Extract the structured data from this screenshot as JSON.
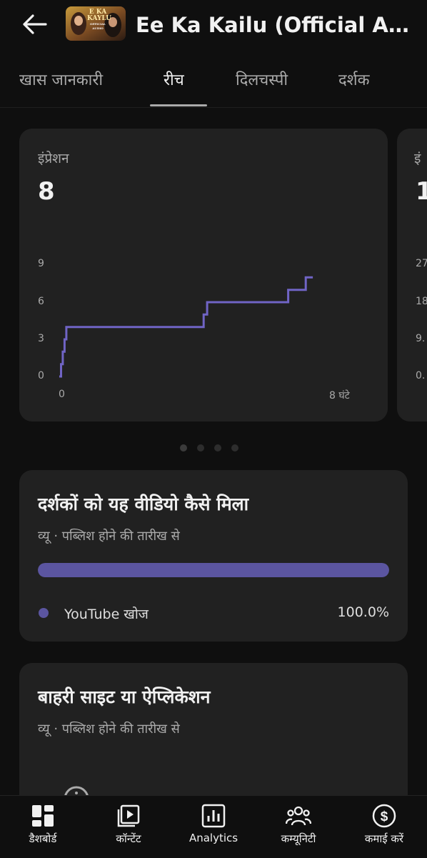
{
  "header": {
    "title": "Ee Ka Kailu (Official Audio)",
    "back_icon": "arrow-left-icon",
    "thumbnail": {
      "line1": "E KA",
      "line2": "KAYLU",
      "line3": "OFFICIAL AUDIO"
    }
  },
  "tabs": [
    {
      "label": "खास जानकारी",
      "active": false
    },
    {
      "label": "रीच",
      "active": true
    },
    {
      "label": "दिलचस्पी",
      "active": false
    },
    {
      "label": "दर्शक",
      "active": false
    }
  ],
  "metric_card": {
    "label": "इंप्रेशन",
    "value": "8",
    "y_ticks": [
      "9",
      "6",
      "3",
      "0"
    ],
    "x_ticks": [
      "0",
      "8 घंटे"
    ]
  },
  "next_card_peek": {
    "label": "इं",
    "value": "1",
    "y_ticks": [
      "27",
      "18",
      "9.",
      "0."
    ]
  },
  "chart_data": {
    "type": "line",
    "title": "इंप्रेशन",
    "xlabel": "",
    "ylabel": "",
    "x_ticks": [
      "0",
      "8 घंटे"
    ],
    "xlim": [
      0,
      8.8
    ],
    "ylim": [
      0,
      9
    ],
    "y_ticks": [
      0,
      3,
      6,
      9
    ],
    "step": true,
    "color": "#7064c5",
    "series": [
      {
        "x": [
          0,
          0.05,
          0.1,
          0.15,
          0.2,
          4.0,
          4.1,
          4.2,
          6.4,
          6.5,
          6.9,
          7.0,
          7.2
        ],
        "y": [
          0,
          1,
          2,
          3,
          4,
          4,
          5,
          6,
          6,
          7,
          7,
          8,
          8
        ]
      }
    ]
  },
  "pager": {
    "count": 4,
    "active": 0
  },
  "traffic_section": {
    "title": "दर्शकों को यह वीडियो कैसे मिला",
    "subtitle": "व्यू · पब्लिश होने की तारीख से",
    "bar_fill_percent": 100,
    "bar_color": "#5b55a0",
    "legend": [
      {
        "label": "YouTube खोज",
        "value": "100.0%",
        "color": "#5b55a0"
      }
    ]
  },
  "external_section": {
    "title": "बाहरी साइट या ऐप्लिकेशन",
    "subtitle": "व्यू · पब्लिश होने की तारीख से",
    "info_icon": "info-icon"
  },
  "bottom_nav": [
    {
      "label": "डैशबोर्ड",
      "icon": "dashboard-icon"
    },
    {
      "label": "कॉन्टेंट",
      "icon": "content-icon"
    },
    {
      "label": "Analytics",
      "icon": "analytics-icon"
    },
    {
      "label": "कम्यूनिटी",
      "icon": "community-icon"
    },
    {
      "label": "कमाई करें",
      "icon": "earn-icon"
    }
  ]
}
